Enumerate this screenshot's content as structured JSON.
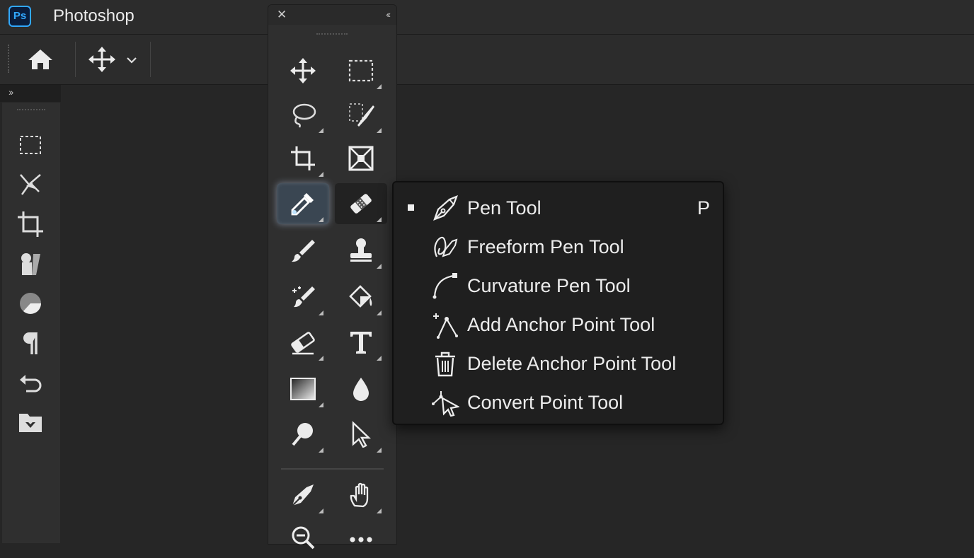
{
  "app": {
    "icon_label": "Ps",
    "title": "Photoshop",
    "brand_color": "#31a8ff"
  },
  "options_bar": {
    "home_icon": "home-icon",
    "move_icon": "move-icon",
    "dropdown_icon": "chevron-down-icon"
  },
  "left_toolbar": {
    "collapse_icon": "double-chevron-right-icon",
    "icons": [
      "marquee-icon",
      "select-subject-icon",
      "crop-icon",
      "properties-icon",
      "color-wheel-icon",
      "paragraph-icon",
      "history-icon",
      "libraries-icon"
    ]
  },
  "floating_toolbar": {
    "close_icon": "close-icon",
    "collapse_icon": "double-chevron-left-icon",
    "tools": [
      {
        "name": "move-tool",
        "icon": "move-icon",
        "has_submenu": false
      },
      {
        "name": "rectangular-marquee-tool",
        "icon": "marquee-icon",
        "has_submenu": true
      },
      {
        "name": "lasso-tool",
        "icon": "lasso-icon",
        "has_submenu": true
      },
      {
        "name": "object-selection-tool",
        "icon": "object-selection-icon",
        "has_submenu": true
      },
      {
        "name": "crop-tool",
        "icon": "crop-icon",
        "has_submenu": true
      },
      {
        "name": "frame-tool",
        "icon": "frame-icon",
        "has_submenu": false
      },
      {
        "name": "eyedropper-tool",
        "icon": "eyedropper-icon",
        "has_submenu": true,
        "state": "active"
      },
      {
        "name": "spot-healing-brush-tool",
        "icon": "healing-brush-icon",
        "has_submenu": true
      },
      {
        "name": "brush-tool",
        "icon": "brush-icon",
        "has_submenu": false
      },
      {
        "name": "clone-stamp-tool",
        "icon": "stamp-icon",
        "has_submenu": true
      },
      {
        "name": "history-brush-tool",
        "icon": "history-brush-icon",
        "has_submenu": true
      },
      {
        "name": "paint-bucket-tool",
        "icon": "paint-bucket-icon",
        "has_submenu": true
      },
      {
        "name": "eraser-tool",
        "icon": "eraser-icon",
        "has_submenu": true
      },
      {
        "name": "type-tool",
        "icon": "type-icon",
        "has_submenu": true
      },
      {
        "name": "gradient-tool",
        "icon": "gradient-icon",
        "has_submenu": true
      },
      {
        "name": "blur-tool",
        "icon": "drop-icon",
        "has_submenu": false
      },
      {
        "name": "dodge-tool",
        "icon": "dodge-icon",
        "has_submenu": true
      },
      {
        "name": "path-selection-tool",
        "icon": "arrow-icon",
        "has_submenu": true
      },
      {
        "name": "pen-tool",
        "icon": "pen-icon",
        "has_submenu": true
      },
      {
        "name": "hand-tool",
        "icon": "hand-icon",
        "has_submenu": true
      },
      {
        "name": "zoom-tool",
        "icon": "zoom-icon",
        "has_submenu": false
      },
      {
        "name": "more-tools",
        "icon": "ellipsis-icon",
        "has_submenu": false
      }
    ]
  },
  "flyout": {
    "items": [
      {
        "label": "Pen Tool",
        "shortcut": "P",
        "icon": "pen-icon",
        "selected": true
      },
      {
        "label": "Freeform Pen Tool",
        "shortcut": "",
        "icon": "freeform-pen-icon",
        "selected": false
      },
      {
        "label": "Curvature Pen Tool",
        "shortcut": "",
        "icon": "curvature-pen-icon",
        "selected": false
      },
      {
        "label": "Add Anchor Point Tool",
        "shortcut": "",
        "icon": "add-anchor-point-icon",
        "selected": false
      },
      {
        "label": "Delete Anchor Point Tool",
        "shortcut": "",
        "icon": "trash-icon",
        "selected": false
      },
      {
        "label": "Convert Point Tool",
        "shortcut": "",
        "icon": "convert-point-icon",
        "selected": false
      }
    ]
  }
}
